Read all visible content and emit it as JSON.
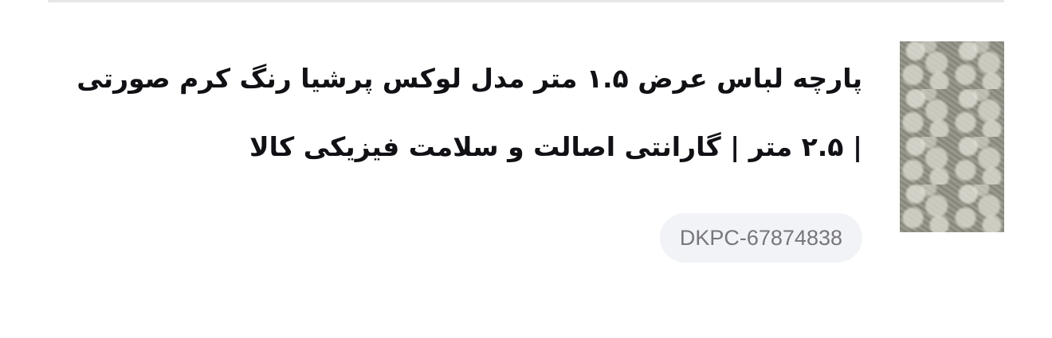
{
  "product": {
    "image_alt": "product thumbnail",
    "title": "پارچه لباس عرض ۱.۵ متر مدل لوکس پرشیا رنگ کرم صورتی | ۲.۵ متر | گارانتی اصالت و سلامت فیزیکی کالا",
    "sku": "DKPC-67874838"
  }
}
